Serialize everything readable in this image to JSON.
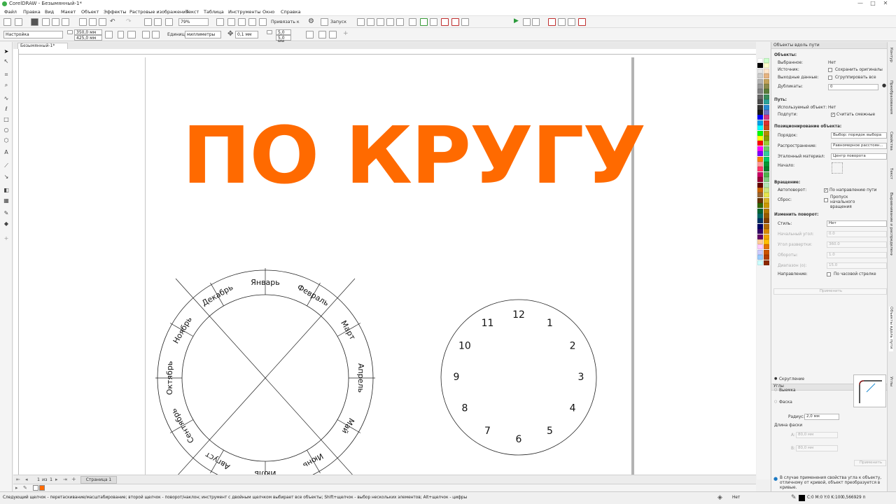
{
  "window": {
    "title": "CorelDRAW - Безымянный-1*",
    "minimize": "—",
    "maximize": "□",
    "close": "✕"
  },
  "menu": [
    "Файл",
    "Правка",
    "Вид",
    "Макет",
    "Объект",
    "Эффекты",
    "Растровые изображения",
    "Текст",
    "Таблица",
    "Инструменты",
    "Окно",
    "Справка"
  ],
  "toolbar1": {
    "zoom": "79%",
    "snap_label": "Привязать к",
    "launch_label": "Запуск"
  },
  "toolbar2": {
    "preset": "Настройка",
    "width": "350,0 мм",
    "height": "425,0 мм",
    "units_label": "Единицы:",
    "units_value": "миллиметры",
    "nudge": "0,1 мм",
    "dup_x": "5,0 мм",
    "dup_y": "5,0 мм"
  },
  "document": {
    "tab": "Безымянный-1*",
    "heading": "ПО КРУГУ"
  },
  "months": [
    "Январь",
    "Февраль",
    "Март",
    "Апрель",
    "Май",
    "Июнь",
    "Июль",
    "Август",
    "Сентябрь",
    "Октябрь",
    "Ноябрь",
    "Декабрь"
  ],
  "clock": [
    "12",
    "1",
    "2",
    "3",
    "4",
    "5",
    "6",
    "7",
    "8",
    "9",
    "10",
    "11"
  ],
  "pages": {
    "current": "1",
    "of": "из",
    "total": "1",
    "tab": "Страница 1"
  },
  "panel_path": {
    "header": "Объекты вдоль пути",
    "objects_title": "Объекты:",
    "selected_label": "Выбранное:",
    "selected_value": "Нет",
    "source_label": "Источник:",
    "keep_originals": "Сохранить оригиналы",
    "output_label": "Выходные данные:",
    "group_all": "Сгруппировать все",
    "duplicates_label": "Дубликаты:",
    "duplicates_value": "0",
    "path_title": "Путь:",
    "used_object_label": "Используемый объект:",
    "used_object_value": "Нет",
    "subpaths_label": "Подпути:",
    "count_adjacent": "Считать смежные",
    "positioning_title": "Позиционирование объекта:",
    "order_label": "Порядок:",
    "order_value": "Выбор: порядок выбора",
    "distribution_label": "Распространение:",
    "distribution_value": "Равномерное расстоян...",
    "reference_label": "Эталонный материал:",
    "reference_value": "Центр поворота",
    "start_label": "Начало:",
    "rotation_title": "Вращение:",
    "autorotate_label": "Автоповорот:",
    "autorotate_value": "По направлению пути",
    "reset_label": "Сброс:",
    "reset_value": "Пропуск начального вращения",
    "change_rotation_title": "Изменить поворот:",
    "style_label": "Стиль:",
    "style_value": "Нет",
    "start_angle_label": "Начальный угол:",
    "start_angle_value": "0.0",
    "sweep_angle_label": "Угол развертки:",
    "sweep_angle_value": "360.0",
    "turns_label": "Обороты:",
    "turns_value": "1.0",
    "increment_label": "Диапазон (о):",
    "increment_value": "15.0",
    "direction_label": "Направление:",
    "direction_value": "По часовой стрелке",
    "apply": "Применить"
  },
  "panel_corners": {
    "header": "Углы",
    "fillet": "Скругление",
    "scallop": "Выемка",
    "chamfer": "Фаска",
    "radius_label": "Радиус:",
    "radius_value": "2,0 мм",
    "chamfer_length": "Длина фаски",
    "a_label": "A:",
    "a_value": "80,0 мм",
    "b_label": "B:",
    "b_value": "80,0 мм",
    "apply": "Применить",
    "info": "В случае применения свойства угла к объекту, отличному от кривой, объект преобразуется в кривые."
  },
  "side_tabs": [
    "Контур",
    "Преобразования",
    "Свойства",
    "Текст",
    "Выравнивание и распределение",
    "Объекты вдоль пути",
    "Углы"
  ],
  "status": {
    "hint": "Следующий щелчок - перетаскивание/масштабирование; второй щелчок - поворот/наклон; инструмент с двойным щелчком выбирает все объекты; Shift+щелчок - выбор нескольких элементов; Alt+щелчок - цифры",
    "fill": "Нет",
    "color": "C:0 M:0 Y:0 K:100",
    "stroke": "0,566929 п"
  },
  "colors": {
    "accent": "#ff6a00"
  },
  "palette": [
    "#ffffff",
    "#000000",
    "#e6e6e6",
    "#cccccc",
    "#b3b3b3",
    "#999999",
    "#808080",
    "#666666",
    "#4d4d4d",
    "#333333",
    "#1a1a1a",
    "#0000ff",
    "#00a0e9",
    "#00ffff",
    "#00ff00",
    "#ffff00",
    "#ff0000",
    "#ff00ff",
    "#8000ff",
    "#ff8000",
    "#ff9999",
    "#ff3366",
    "#cc0066",
    "#990033",
    "#660000",
    "#cc6600",
    "#996633",
    "#663300",
    "#336600",
    "#006633",
    "#006666",
    "#003366",
    "#000066",
    "#330066",
    "#660066",
    "#ffcc99",
    "#ffccff",
    "#ccccff",
    "#99ccff",
    "#ccffff",
    "#ccffcc",
    "#ffffcc",
    "#ffe6cc",
    "#e6b380",
    "#c4a35a",
    "#8b8b4b",
    "#5a7d3a",
    "#3a8d5a",
    "#2aa198",
    "#268bd2",
    "#6c71c4",
    "#d33682",
    "#dc322f",
    "#cb4b16",
    "#b58900",
    "#859900",
    "#99cc33",
    "#66cc66",
    "#33cc99",
    "#00cc66",
    "#009933",
    "#00802b",
    "#4db34d",
    "#80cc80",
    "#b3e6b3",
    "#cce680",
    "#e6e64d",
    "#d9b326",
    "#cc9900",
    "#b37700",
    "#995c00",
    "#804000",
    "#b36b00",
    "#d98c00",
    "#f2a600",
    "#ffbf00",
    "#e67300",
    "#cc5200",
    "#b33c00",
    "#8c2a00"
  ]
}
